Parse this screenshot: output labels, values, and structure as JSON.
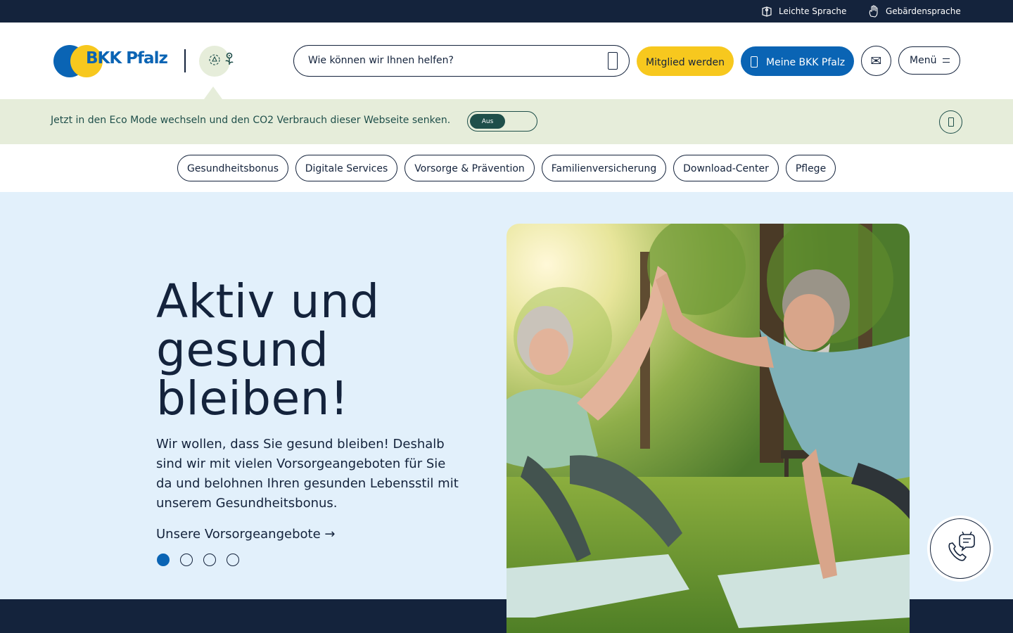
{
  "utility_bar": {
    "leichte_sprache": "Leichte Sprache",
    "gebaerdensprache": "Gebärdensprache"
  },
  "header": {
    "logo_text": "BKK Pfalz",
    "search_placeholder": "Wie können wir Ihnen helfen?",
    "member_button": "Mitglied werden",
    "meine_button": "Meine BKK Pfalz",
    "menu_button": "Menü"
  },
  "eco_banner": {
    "text": "Jetzt in den Eco Mode wechseln und den CO2 Verbrauch dieser Webseite senken.",
    "toggle_state": "Aus"
  },
  "quick_nav": [
    "Gesundheitsbonus",
    "Digitale Services",
    "Vorsorge & Prävention",
    "Familienversicherung",
    "Download-Center",
    "Pflege"
  ],
  "hero": {
    "title": "Aktiv und gesund bleiben!",
    "text": "Wir wollen, dass Sie gesund bleiben! Deshalb sind wir mit vielen Vorsorgeangeboten für Sie da und belohnen Ihren gesunden Lebensstil mit unserem Gesundheitsbonus.",
    "link": "Unsere Vorsorgeangebote →",
    "slides_total": 4,
    "active_slide": 1
  },
  "colors": {
    "navy": "#14233c",
    "brand_blue": "#0a64b4",
    "brand_yellow": "#f7c81e",
    "eco_green": "#e6edda",
    "hero_bg": "#e2f0fb"
  },
  "icons": {
    "leichte_sprache": "book-icon",
    "gebaerdensprache": "hand-icon",
    "eco": "recycle-icon",
    "mail": "mail-icon",
    "contact": "phone-chat-icon"
  }
}
